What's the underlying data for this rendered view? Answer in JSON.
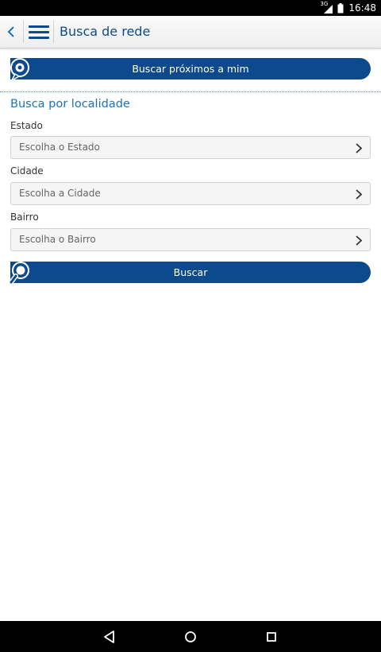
{
  "status_bar": {
    "network": "3G",
    "time": "16:48"
  },
  "app_bar": {
    "title": "Busca de rede"
  },
  "nearby_button": {
    "label": "Buscar próximos a mim"
  },
  "section": {
    "title": "Busca por localidade"
  },
  "fields": {
    "estado": {
      "label": "Estado",
      "placeholder": "Escolha o Estado"
    },
    "cidade": {
      "label": "Cidade",
      "placeholder": "Escolha a Cidade"
    },
    "bairro": {
      "label": "Bairro",
      "placeholder": "Escolha o Bairro"
    }
  },
  "search_button": {
    "label": "Buscar"
  },
  "icons": {
    "back": "back-chevron-icon",
    "menu": "hamburger-menu-icon",
    "location": "location-pin-icon",
    "search": "magnifier-icon",
    "nav_back": "nav-back-icon",
    "nav_home": "nav-home-icon",
    "nav_recents": "nav-recents-icon"
  },
  "colors": {
    "brand": "#0d4a8d",
    "accent": "#1e72b5"
  }
}
